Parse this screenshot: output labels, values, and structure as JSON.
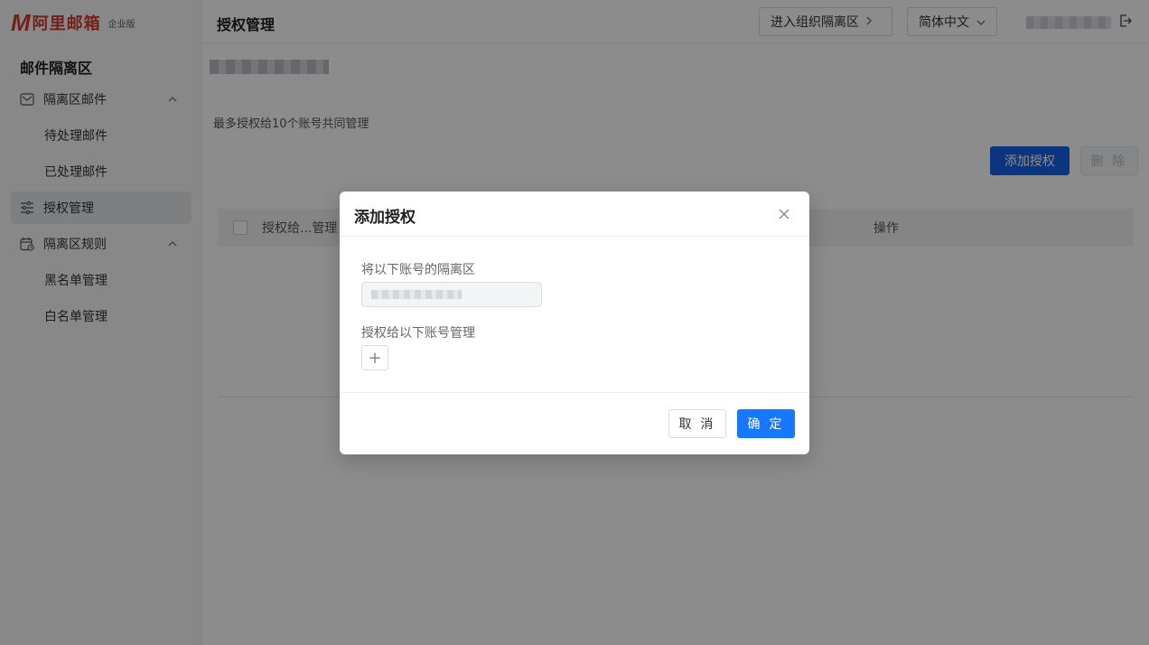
{
  "brand": {
    "logo_letter": "M",
    "name": "阿里邮箱",
    "edition": "企业版",
    "color": "#d23b2f"
  },
  "sidebar": {
    "title": "邮件隔离区",
    "items": [
      {
        "label": "隔离区邮件",
        "icon": "mail-icon",
        "expanded": true
      },
      {
        "label": "待处理邮件"
      },
      {
        "label": "已处理邮件"
      },
      {
        "label": "授权管理",
        "icon": "sliders-icon",
        "active": true
      },
      {
        "label": "隔离区规则",
        "icon": "calendar-icon",
        "expanded": true
      },
      {
        "label": "黑名单管理"
      },
      {
        "label": "白名单管理"
      }
    ]
  },
  "header": {
    "title": "授权管理",
    "org_button": "进入组织隔离区",
    "lang_select": "简体中文",
    "logout_icon": "logout-icon"
  },
  "main": {
    "hint": "最多授权给10个账号共同管理",
    "add_button": "添加授权",
    "delete_button": "删 除",
    "table": {
      "col1": "授权给...管理",
      "col2": "操作"
    }
  },
  "modal": {
    "title": "添加授权",
    "label_source": "将以下账号的隔离区",
    "label_target": "授权给以下账号管理",
    "add_glyph": "+",
    "cancel": "取 消",
    "ok": "确 定"
  },
  "colors": {
    "primary": "#1662e8",
    "ok_button": "#1677ff"
  }
}
